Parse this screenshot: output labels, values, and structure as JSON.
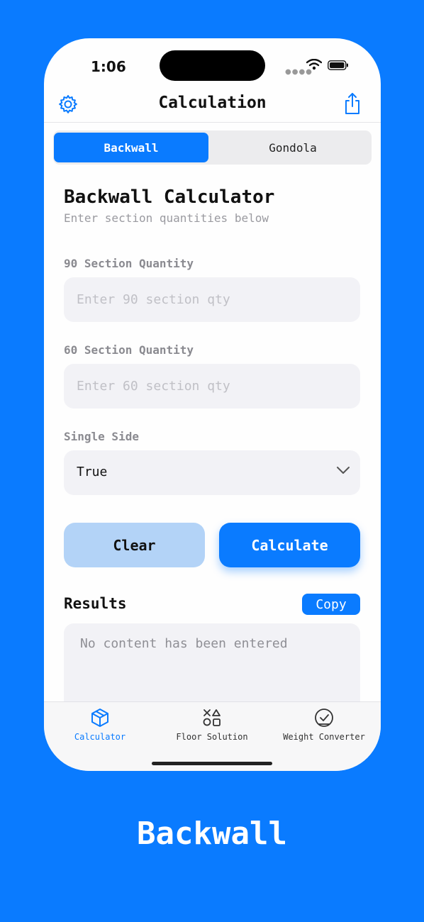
{
  "status": {
    "time": "1:06"
  },
  "navbar": {
    "title": "Calculation"
  },
  "segment": {
    "options": [
      "Backwall",
      "Gondola"
    ],
    "selected": "Backwall"
  },
  "form": {
    "heading": "Backwall Calculator",
    "subheading": "Enter section quantities below",
    "field90": {
      "label": "90 Section Quantity",
      "placeholder": "Enter 90 section qty",
      "value": ""
    },
    "field60": {
      "label": "60 Section Quantity",
      "placeholder": "Enter 60 section qty",
      "value": ""
    },
    "single_side": {
      "label": "Single Side",
      "value": "True"
    },
    "clear_label": "Clear",
    "calculate_label": "Calculate"
  },
  "results": {
    "title": "Results",
    "copy_label": "Copy",
    "content": "No content has been entered"
  },
  "tabs": [
    {
      "label": "Calculator",
      "icon": "cube-icon",
      "active": true
    },
    {
      "label": "Floor Solution",
      "icon": "shapes-icon",
      "active": false
    },
    {
      "label": "Weight Converter",
      "icon": "scale-icon",
      "active": false
    }
  ],
  "caption": "Backwall",
  "colors": {
    "accent": "#0a7bff",
    "clear_button": "#b3d3f7",
    "field_bg": "#f2f2f6"
  }
}
